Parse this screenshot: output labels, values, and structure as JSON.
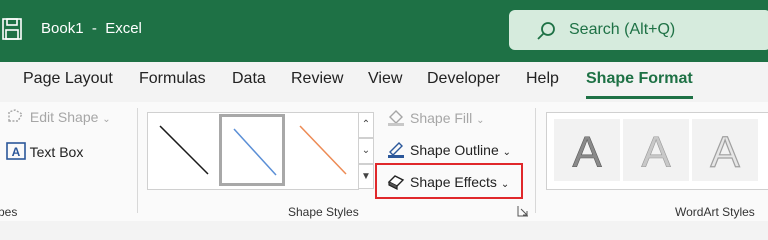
{
  "title_bar": {
    "app_title": "Book1  -  Excel",
    "search_label": "Search (Alt+Q)"
  },
  "tabs": [
    {
      "label": "Page Layout",
      "active": false
    },
    {
      "label": "Formulas",
      "active": false
    },
    {
      "label": "Data",
      "active": false
    },
    {
      "label": "Review",
      "active": false
    },
    {
      "label": "View",
      "active": false
    },
    {
      "label": "Developer",
      "active": false
    },
    {
      "label": "Help",
      "active": false
    },
    {
      "label": "Shape Format",
      "active": true
    }
  ],
  "ribbon": {
    "insert_shapes": {
      "edit_shape": "Edit Shape",
      "text_box": "Text Box",
      "group_label": "pes"
    },
    "shape_styles": {
      "styles": [
        {
          "name": "black-line",
          "color": "#1a1a1a"
        },
        {
          "name": "blue-line",
          "color": "#5b8fd6"
        },
        {
          "name": "orange-line",
          "color": "#ed8b55"
        }
      ],
      "shape_fill": "Shape Fill",
      "shape_outline": "Shape Outline",
      "shape_effects": "Shape Effects",
      "group_label": "Shape Styles"
    },
    "wordart": {
      "letters": [
        "A",
        "A",
        "A"
      ],
      "group_label": "WordArt Styles"
    }
  },
  "colors": {
    "accent": "#1e7145",
    "search_bg": "#d6ebdd",
    "highlight": "#e0282b"
  }
}
